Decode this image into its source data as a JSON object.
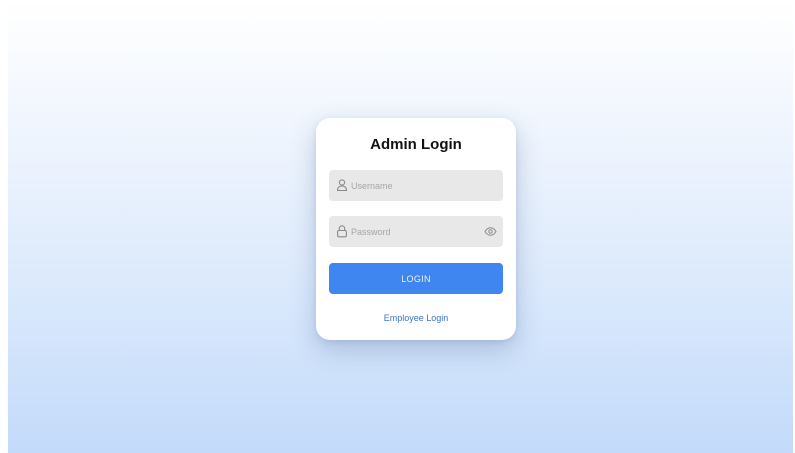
{
  "login_card": {
    "title": "Admin Login",
    "username": {
      "placeholder": "Username",
      "value": "",
      "icon": "user-icon"
    },
    "password": {
      "placeholder": "Password",
      "value": "",
      "icon": "lock-icon",
      "toggle_icon": "eye-icon"
    },
    "login_button_label": "LOGIN",
    "alt_link_label": "Employee Login"
  },
  "colors": {
    "primary": "#3f86f1",
    "link": "#3a74c8",
    "field_bg": "#e8e8e8",
    "background_top": "#ffffff",
    "background_bottom": "#c3dafa"
  }
}
